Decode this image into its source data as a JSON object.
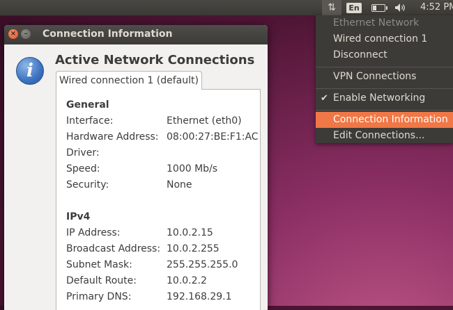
{
  "panel": {
    "keyboard_layout": "En",
    "clock": "4:52 PM",
    "icons": [
      "network-updown-icon",
      "keyboard-layout-indicator",
      "battery-icon",
      "volume-icon"
    ]
  },
  "menu": {
    "items": [
      {
        "label": "Ethernet Network",
        "state": "disabled"
      },
      {
        "label": "Wired connection 1"
      },
      {
        "label": "Disconnect"
      },
      {
        "label": "VPN Connections"
      },
      {
        "label": "Enable Networking",
        "checked": true
      },
      {
        "label": "Connection Information",
        "state": "highlighted"
      },
      {
        "label": "Edit Connections..."
      }
    ]
  },
  "window": {
    "title": "Connection Information",
    "heading": "Active Network Connections",
    "tab_label": "Wired connection 1 (default)",
    "general": {
      "title": "General",
      "rows": [
        {
          "label": "Interface:",
          "value": "Ethernet (eth0)"
        },
        {
          "label": "Hardware Address:",
          "value": "08:00:27:BE:F1:AC"
        },
        {
          "label": "Driver:",
          "value": ""
        },
        {
          "label": "Speed:",
          "value": "1000 Mb/s"
        },
        {
          "label": "Security:",
          "value": "None"
        }
      ]
    },
    "ipv4": {
      "title": "IPv4",
      "rows": [
        {
          "label": "IP Address:",
          "value": "10.0.2.15"
        },
        {
          "label": "Broadcast Address:",
          "value": "10.0.2.255"
        },
        {
          "label": "Subnet Mask:",
          "value": "255.255.255.0"
        },
        {
          "label": "Default Route:",
          "value": "10.0.2.2"
        },
        {
          "label": "Primary DNS:",
          "value": "192.168.29.1"
        }
      ]
    }
  },
  "colors": {
    "panel": "#3c3b37",
    "menu_highlight": "#f07746",
    "wallpaper": "#5e2750"
  }
}
